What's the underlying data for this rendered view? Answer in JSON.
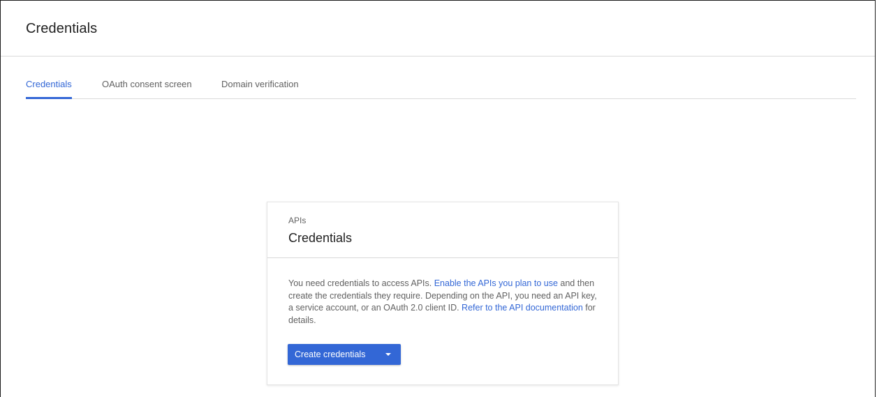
{
  "page": {
    "title": "Credentials"
  },
  "tabs": [
    {
      "label": "Credentials",
      "active": true
    },
    {
      "label": "OAuth consent screen",
      "active": false
    },
    {
      "label": "Domain verification",
      "active": false
    }
  ],
  "card": {
    "eyebrow": "APIs",
    "title": "Credentials",
    "body": {
      "text_1": "You need credentials to access APIs. ",
      "link_1": "Enable the APIs you plan to use",
      "text_2": " and then create the credentials they require. Depending on the API, you need an API key, a service account, or an OAuth 2.0 client ID. ",
      "link_2": "Refer to the API documentation",
      "text_3": " for details."
    },
    "button_label": "Create credentials",
    "button_icon": "caret-down-icon"
  },
  "colors": {
    "accent": "#3367d6",
    "text_primary": "#212121",
    "text_secondary": "#616161",
    "divider": "#dadada"
  }
}
